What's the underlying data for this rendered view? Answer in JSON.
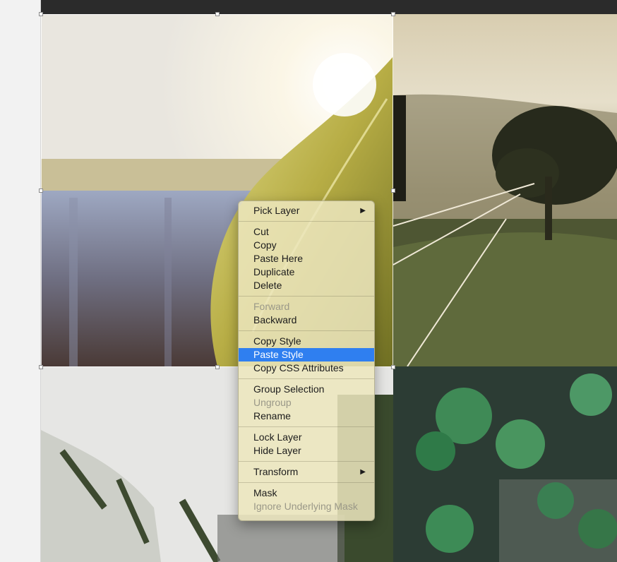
{
  "context_menu": {
    "groups": [
      [
        {
          "label": "Pick Layer",
          "submenu": true
        }
      ],
      [
        {
          "label": "Cut"
        },
        {
          "label": "Copy"
        },
        {
          "label": "Paste Here"
        },
        {
          "label": "Duplicate"
        },
        {
          "label": "Delete"
        }
      ],
      [
        {
          "label": "Forward",
          "disabled": true
        },
        {
          "label": "Backward"
        }
      ],
      [
        {
          "label": "Copy Style"
        },
        {
          "label": "Paste Style",
          "highlighted": true
        },
        {
          "label": "Copy CSS Attributes"
        }
      ],
      [
        {
          "label": "Group Selection"
        },
        {
          "label": "Ungroup",
          "disabled": true
        },
        {
          "label": "Rename"
        }
      ],
      [
        {
          "label": "Lock Layer"
        },
        {
          "label": "Hide Layer"
        }
      ],
      [
        {
          "label": "Transform",
          "submenu": true
        }
      ],
      [
        {
          "label": "Mask"
        },
        {
          "label": "Ignore Underlying Mask",
          "disabled": true
        }
      ]
    ],
    "submenu_arrow": "▶"
  },
  "colors": {
    "highlight": "#2f7ff0",
    "menu_background": "#ece6be",
    "top_bar": "#2b2b2b"
  }
}
